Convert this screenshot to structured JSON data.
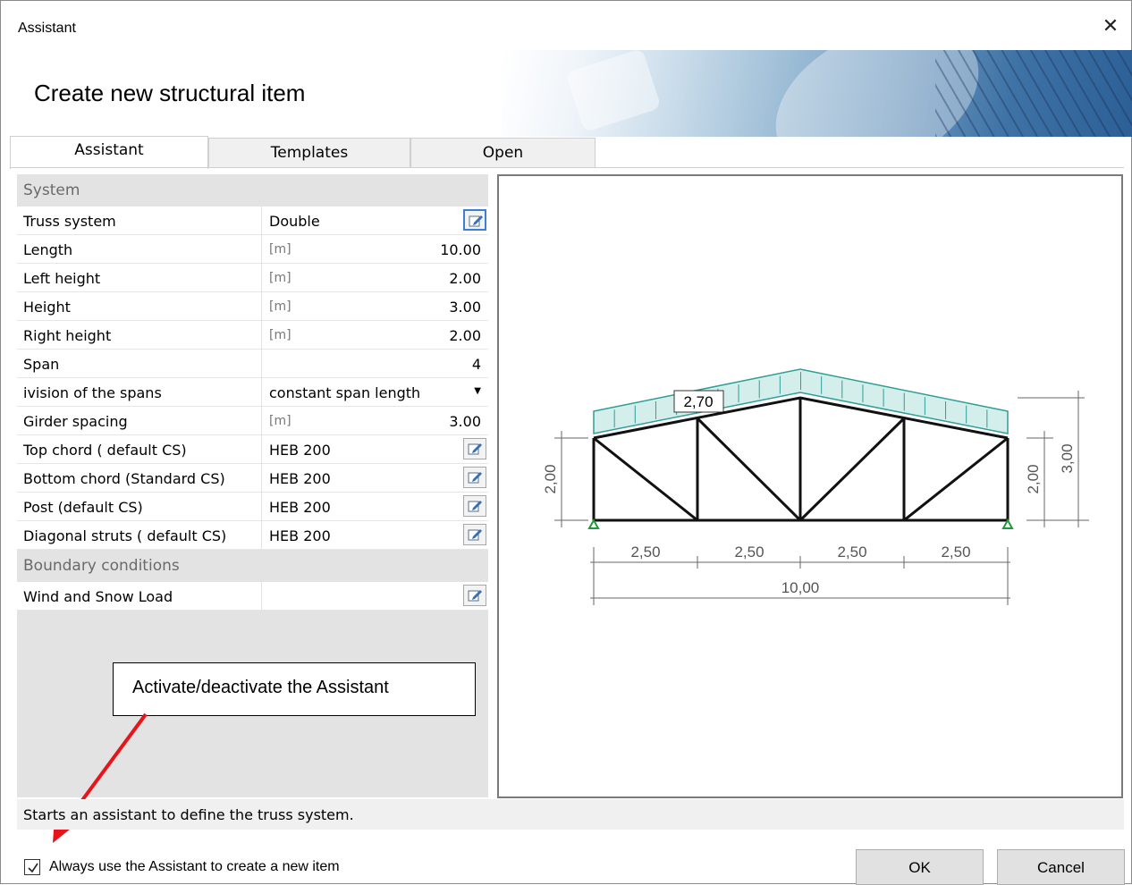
{
  "window": {
    "title": "Assistant",
    "close_glyph": "✕"
  },
  "heading": "Create new structural item",
  "tabs": [
    "Assistant",
    "Templates",
    "Open"
  ],
  "properties": {
    "section_system": "System",
    "rows": [
      {
        "name": "Truss system",
        "unit": "",
        "value": "Double",
        "control": "edit"
      },
      {
        "name": "Length",
        "unit": "[m]",
        "value": "10.00"
      },
      {
        "name": "Left height",
        "unit": "[m]",
        "value": "2.00"
      },
      {
        "name": "Height",
        "unit": "[m]",
        "value": "3.00"
      },
      {
        "name": "Right height",
        "unit": "[m]",
        "value": "2.00"
      },
      {
        "name": "Span",
        "unit": "",
        "value": "4"
      },
      {
        "name": "ivision of the spans",
        "unit": "",
        "value": "constant span length",
        "control": "dropdown"
      },
      {
        "name": "Girder spacing",
        "unit": "[m]",
        "value": "3.00"
      },
      {
        "name": "Top chord ( default CS)",
        "unit": "",
        "value": "HEB 200",
        "control": "edit"
      },
      {
        "name": "Bottom chord (Standard CS)",
        "unit": "",
        "value": "HEB 200",
        "control": "edit"
      },
      {
        "name": "Post (default CS)",
        "unit": "",
        "value": "HEB 200",
        "control": "edit"
      },
      {
        "name": "Diagonal struts ( default CS)",
        "unit": "",
        "value": "HEB 200",
        "control": "edit"
      }
    ],
    "section_boundary": "Boundary conditions",
    "boundary_rows": [
      {
        "name": "Wind and Snow Load",
        "unit": "",
        "value": "",
        "control": "edit"
      }
    ]
  },
  "hint_box": "Activate/deactivate the Assistant",
  "status_text": "Starts an assistant to define the truss system.",
  "preview": {
    "load_label": "2,70",
    "span_labels": [
      "2,50",
      "2,50",
      "2,50",
      "2,50"
    ],
    "total_length": "10,00",
    "left_height": "2,00",
    "right_height": "2,00",
    "ridge_height": "3,00"
  },
  "footer": {
    "checkbox_label": "Always use the Assistant to create a new item",
    "checkbox_checked": true,
    "ok_label": "OK",
    "cancel_label": "Cancel"
  },
  "colors": {
    "focus_blue": "#3c7fd8",
    "arrow_red": "#e8141b",
    "load_teal": "#2f9e95"
  },
  "icons": {
    "close": "close-icon",
    "edit": "edit-icon",
    "dropdown": "chevron-down-icon",
    "check": "check-icon"
  }
}
